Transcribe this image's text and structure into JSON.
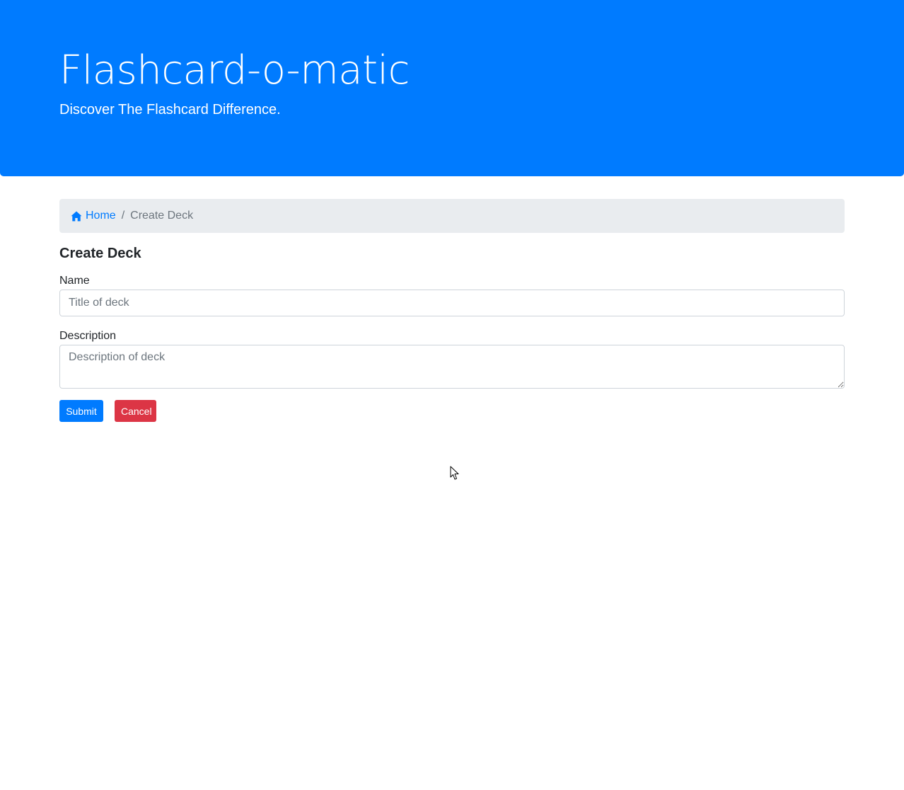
{
  "header": {
    "title": "Flashcard-o-matic",
    "subtitle": "Discover The Flashcard Difference."
  },
  "breadcrumb": {
    "home_icon": "home-icon",
    "home_label": "Home",
    "separator": "/",
    "current": "Create Deck"
  },
  "form": {
    "title": "Create Deck",
    "name": {
      "label": "Name",
      "value": "",
      "placeholder": "Title of deck"
    },
    "description": {
      "label": "Description",
      "value": "",
      "placeholder": "Description of deck"
    },
    "submit_label": "Submit",
    "cancel_label": "Cancel"
  },
  "colors": {
    "primary": "#007bff",
    "danger": "#dc3545",
    "breadcrumb_bg": "#e9ecef",
    "muted": "#6c757d"
  }
}
